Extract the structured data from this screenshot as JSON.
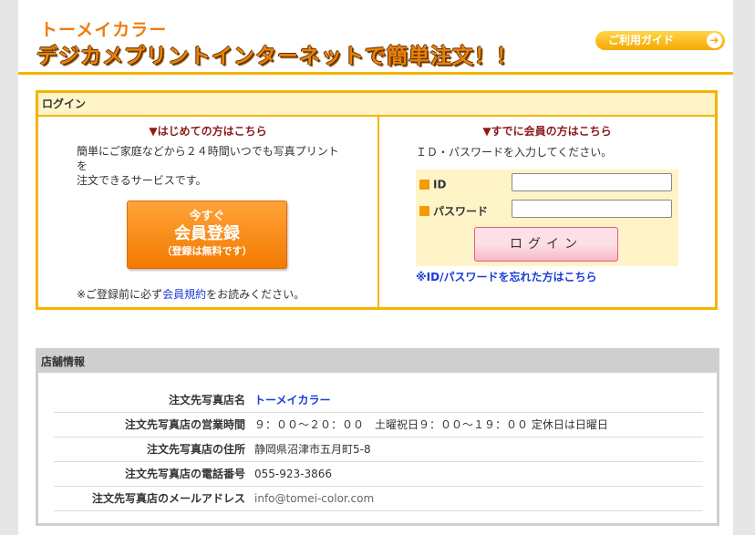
{
  "header": {
    "brand": "トーメイカラー",
    "tagline": "デジカメプリントインターネットで簡単注文！！",
    "guide_label": "ご利用ガイド"
  },
  "login": {
    "title": "ログイン",
    "new_user": {
      "heading": "▼はじめての方はこちら",
      "intro_line1": "簡単にご家庭などから２４時間いつでも写真プリント",
      "intro_line2": "を",
      "intro_line3": "注文できるサービスです。",
      "button_line1": "今すぐ",
      "button_line2": "会員登録",
      "button_line3": "（登録は無料です）",
      "notice_prefix": "※ご登録前に必ず",
      "notice_link": "会員規約",
      "notice_suffix": "をお読みください。"
    },
    "member": {
      "heading": "▼すでに会員の方はこちら",
      "instruction": "ＩＤ・パスワードを入力してください。",
      "id_label": "ID",
      "id_value": "",
      "password_label": "パスワード",
      "password_value": "",
      "login_button": "ログイン",
      "forgot_link": "※ID/パスワードを忘れた方はこちら"
    }
  },
  "store": {
    "title": "店舗情報",
    "rows": [
      {
        "label": "注文先写真店名",
        "value": "トーメイカラー"
      },
      {
        "label": "注文先写真店の営業時間",
        "value": "９：００～２０：００　土曜祝日９：００～１９：００ 定休日は日曜日"
      },
      {
        "label": "注文先写真店の住所",
        "value": "静岡県沼津市五月町5-8"
      },
      {
        "label": "注文先写真店の電話番号",
        "value": "055-923-3866"
      },
      {
        "label": "注文先写真店のメールアドレス",
        "value": "info@tomei-color.com"
      }
    ]
  },
  "colors": {
    "accent": "#f4b400",
    "brand": "#f07a10",
    "link": "#1a3bd6",
    "heading": "#8b1a1a"
  }
}
